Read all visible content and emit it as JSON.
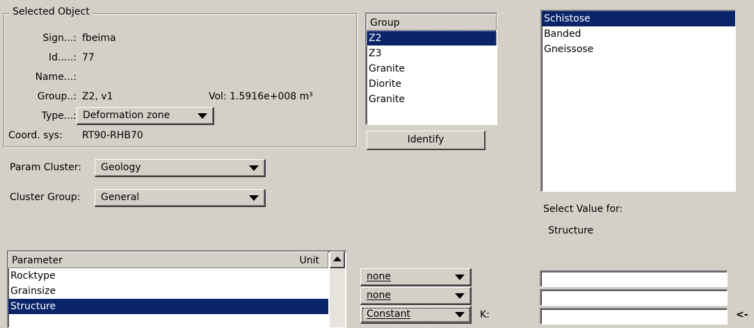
{
  "selected_object": {
    "legend": "Selected Object",
    "sign_label": "Sign...:",
    "sign_value": "fbeima",
    "id_label": "Id.....:",
    "id_value": "77",
    "name_label": "Name...:",
    "name_value": "",
    "group_label": "Group..:",
    "group_value": "Z2, v1",
    "vol_label": "Vol: 1.5916e+008 m³",
    "type_label": "Type...:",
    "type_value": "Deformation zone",
    "coord_label": "Coord. sys:",
    "coord_value": "RT90-RHB70"
  },
  "param_cluster": {
    "label": "Param Cluster:",
    "value": "Geology"
  },
  "cluster_group": {
    "label": "Cluster Group:",
    "value": "General"
  },
  "group_list": {
    "header": "Group",
    "items": [
      {
        "label": "Z2",
        "selected": true
      },
      {
        "label": "Z3",
        "selected": false
      },
      {
        "label": "Granite",
        "selected": false
      },
      {
        "label": "Diorite",
        "selected": false
      },
      {
        "label": "Granite",
        "selected": false
      }
    ]
  },
  "identify_button": "Identify",
  "value_list": {
    "items": [
      {
        "label": "Schistose",
        "selected": true
      },
      {
        "label": "Banded",
        "selected": false
      },
      {
        "label": "Gneissose",
        "selected": false
      }
    ]
  },
  "select_value": {
    "label": "Select Value for:",
    "param": "Structure"
  },
  "parameter_table": {
    "col_parameter": "Parameter",
    "col_unit": "Unit",
    "rows": [
      {
        "label": "Rocktype",
        "selected": false
      },
      {
        "label": "Grainsize",
        "selected": false
      },
      {
        "label": "Structure",
        "selected": true
      }
    ]
  },
  "row_combos": [
    "none",
    "none",
    "Constant"
  ],
  "k_label": "K:",
  "arrow_label": "<-",
  "colors": {
    "selection": "#0a246a",
    "face": "#d4d0c8"
  }
}
